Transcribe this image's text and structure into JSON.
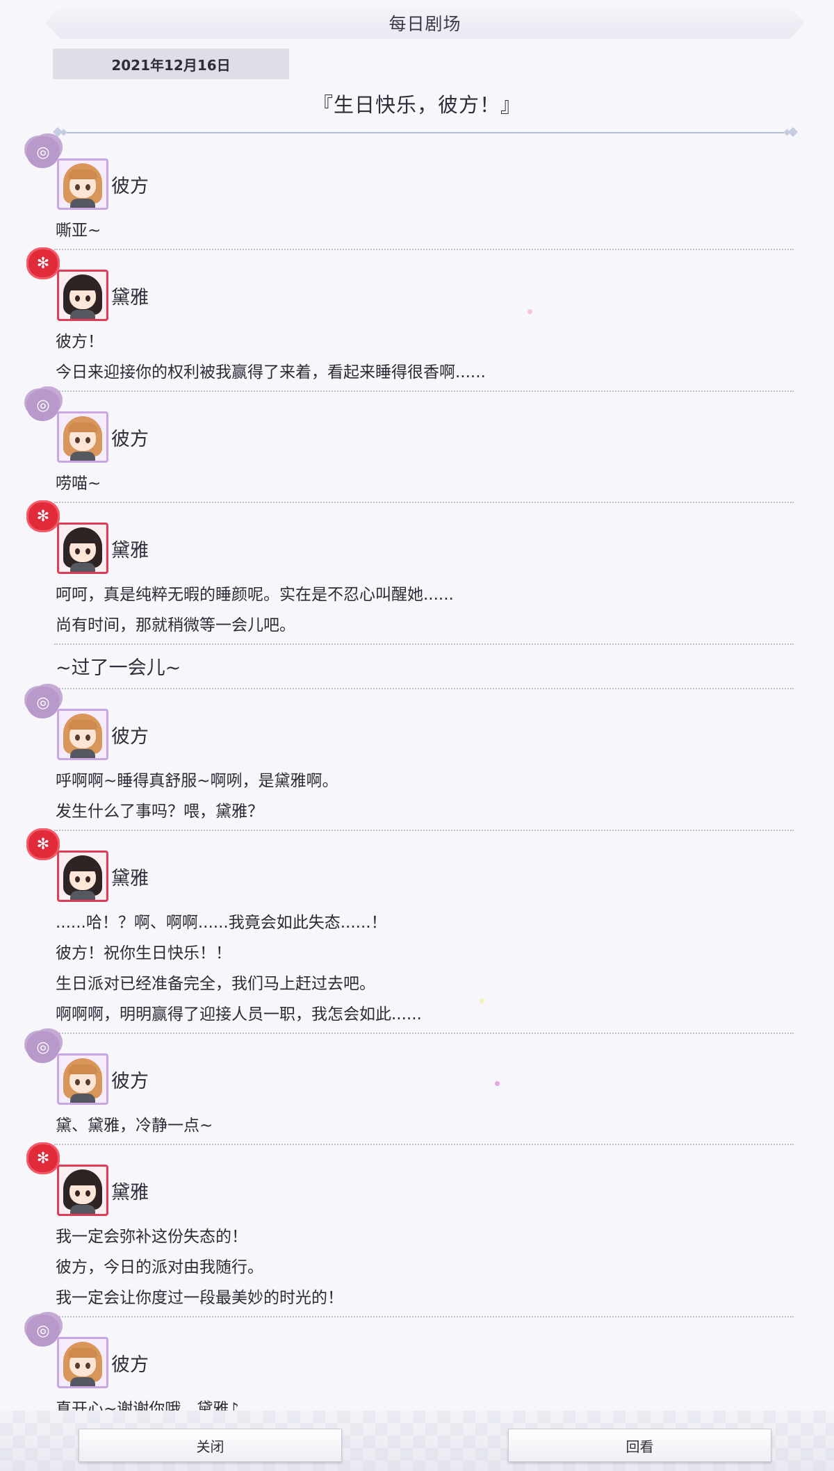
{
  "header": {
    "title": "每日剧场",
    "date": "2021年12月16日",
    "story_title": "『生日快乐，彼方！』"
  },
  "speakers": {
    "kanata": {
      "name": "彼方",
      "badge_icon": "sheep-icon",
      "frame_color": "#c9a7e2"
    },
    "yuri": {
      "name": "黛雅",
      "badge_icon": "plum-flower-icon",
      "frame_color": "#e03b57"
    }
  },
  "dialogue": [
    {
      "speaker": "彼方",
      "lines": [
        "嘶亚~"
      ]
    },
    {
      "speaker": "黛雅",
      "lines": [
        "彼方！",
        "今日来迎接你的权利被我赢得了来着，看起来睡得很香啊......"
      ]
    },
    {
      "speaker": "彼方",
      "lines": [
        "唠喵~"
      ]
    },
    {
      "speaker": "黛雅",
      "lines": [
        "呵呵，真是纯粹无暇的睡颜呢。实在是不忍心叫醒她......",
        "尚有时间，那就稍微等一会儿吧。"
      ]
    },
    {
      "narration": "~过了一会儿~"
    },
    {
      "speaker": "彼方",
      "lines": [
        "呼啊啊~睡得真舒服~啊咧，是黛雅啊。",
        "发生什么了事吗？喂，黛雅？"
      ]
    },
    {
      "speaker": "黛雅",
      "lines": [
        "......哈！？啊、啊啊......我竟会如此失态......！",
        "彼方！祝你生日快乐！！",
        "生日派对已经准备完全，我们马上赶过去吧。",
        "啊啊啊，明明赢得了迎接人员一职，我怎会如此......"
      ]
    },
    {
      "speaker": "彼方",
      "lines": [
        "黛、黛雅，冷静一点~"
      ]
    },
    {
      "speaker": "黛雅",
      "lines": [
        "我一定会弥补这份失态的！",
        "彼方，今日的派对由我随行。",
        "我一定会让你度过一段最美妙的时光的！"
      ]
    },
    {
      "speaker": "彼方",
      "lines": [
        "真开心~谢谢你哦，黛雅♪"
      ]
    }
  ],
  "footer": {
    "close_label": "关闭",
    "replay_label": "回看"
  }
}
